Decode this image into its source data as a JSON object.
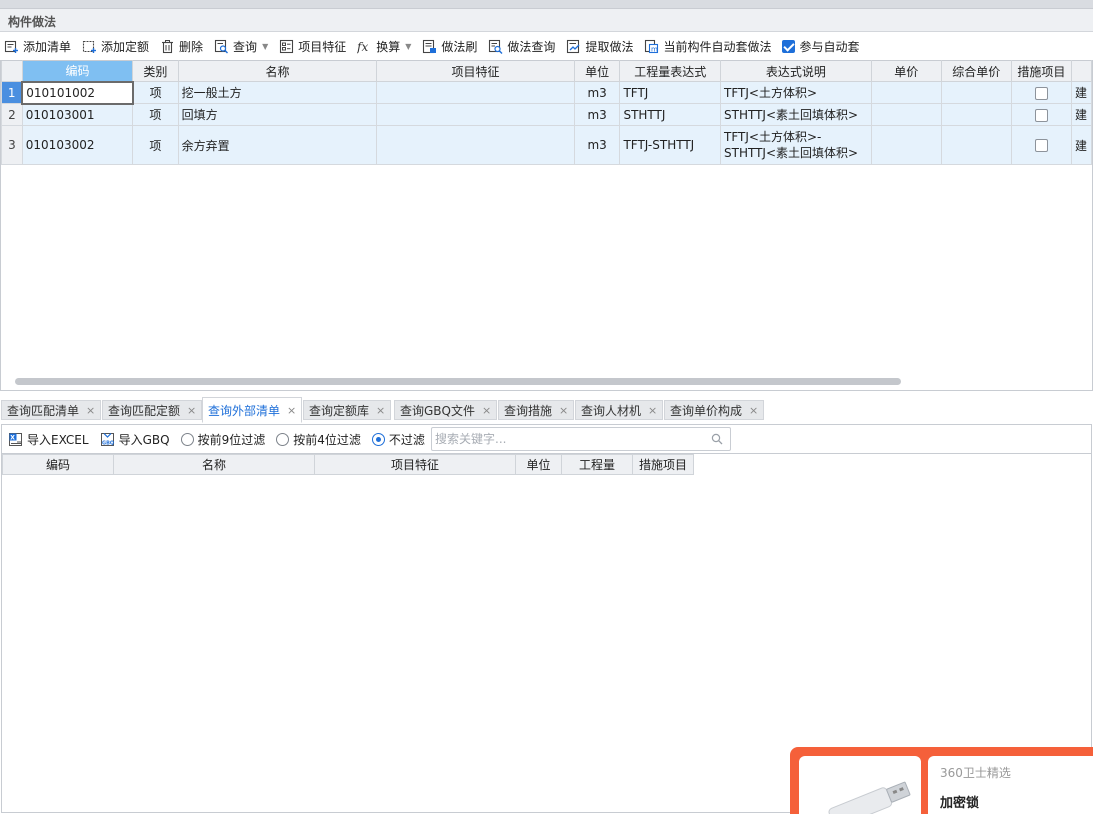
{
  "panel": {
    "title": "构件做法"
  },
  "toolbar": {
    "items": [
      {
        "label": "添加清单",
        "icon": "add-list-icon"
      },
      {
        "label": "添加定额",
        "icon": "add-quota-icon"
      },
      {
        "label": "删除",
        "icon": "trash-icon"
      },
      {
        "label": "查询",
        "icon": "query-icon"
      },
      {
        "label": "项目特征",
        "icon": "feature-icon"
      },
      {
        "label": "换算",
        "icon": "fx-icon"
      },
      {
        "label": "做法刷",
        "icon": "brush-icon"
      },
      {
        "label": "做法查询",
        "icon": "method-query-icon"
      },
      {
        "label": "提取做法",
        "icon": "extract-icon"
      },
      {
        "label": "当前构件自动套做法",
        "icon": "auto-apply-icon"
      }
    ],
    "auto_checkbox": {
      "label": "参与自动套",
      "checked": true
    }
  },
  "grid": {
    "columns": [
      "编码",
      "类别",
      "名称",
      "项目特征",
      "单位",
      "工程量表达式",
      "表达式说明",
      "单价",
      "综合单价",
      "措施项目"
    ],
    "rows": [
      {
        "num": "1",
        "code": "010101002",
        "type": "项",
        "name": "挖一般土方",
        "feature": "",
        "unit": "m3",
        "expr": "TFTJ",
        "desc": "TFTJ<土方体积>",
        "price": "",
        "total": "",
        "measure": false,
        "extra": "建"
      },
      {
        "num": "2",
        "code": "010103001",
        "type": "项",
        "name": "回填方",
        "feature": "",
        "unit": "m3",
        "expr": "STHTTJ",
        "desc": "STHTTJ<素土回填体积>",
        "price": "",
        "total": "",
        "measure": false,
        "extra": "建"
      },
      {
        "num": "3",
        "code": "010103002",
        "type": "项",
        "name": "余方弃置",
        "feature": "",
        "unit": "m3",
        "expr": "TFTJ-STHTTJ",
        "desc_line1": "TFTJ<土方体积>-",
        "desc_line2": "STHTTJ<素土回填体积>",
        "price": "",
        "total": "",
        "measure": false,
        "extra": "建"
      }
    ]
  },
  "tabs": {
    "items": [
      {
        "label": "查询匹配清单"
      },
      {
        "label": "查询匹配定额"
      },
      {
        "label": "查询外部清单",
        "active": true
      },
      {
        "label": "查询定额库"
      },
      {
        "label": "查询GBQ文件"
      },
      {
        "label": "查询措施"
      },
      {
        "label": "查询人材机"
      },
      {
        "label": "查询单价构成"
      }
    ],
    "close": "×"
  },
  "toolbar2": {
    "import_excel": "导入EXCEL",
    "import_gbq": "导入GBQ",
    "filter9": "按前9位过滤",
    "filter4": "按前4位过滤",
    "nofilter": "不过滤",
    "selected_filter": "不过滤",
    "search_placeholder": "搜索关键字..."
  },
  "grid2": {
    "columns": [
      "编码",
      "名称",
      "项目特征",
      "单位",
      "工程量",
      "措施项目"
    ]
  },
  "ad": {
    "brand": "360卫士精选",
    "product": "加密锁"
  },
  "colors": {
    "accent": "#1e6fd9",
    "selected_header": "#7fbff2",
    "row_bg": "#e6f2fc",
    "ad_orange": "#f5603a"
  }
}
